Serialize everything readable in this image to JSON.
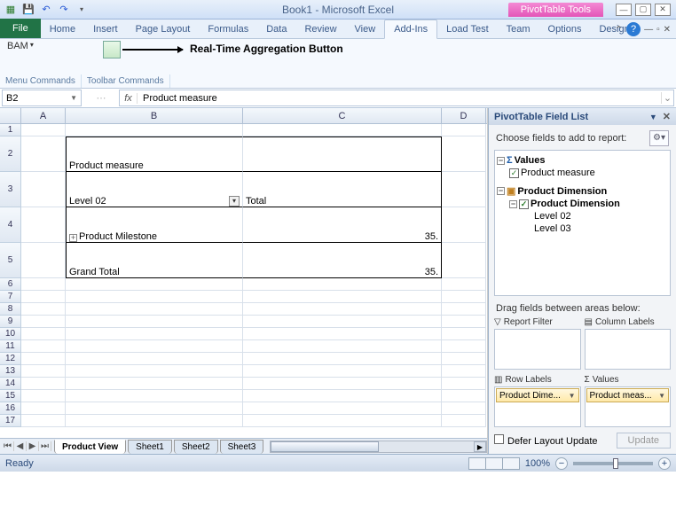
{
  "title": "Book1 - Microsoft Excel",
  "contextual_tab": "PivotTable Tools",
  "file_tab": "File",
  "tabs": [
    "Home",
    "Insert",
    "Page Layout",
    "Formulas",
    "Data",
    "Review",
    "View",
    "Add-Ins",
    "Load Test",
    "Team",
    "Options",
    "Design"
  ],
  "active_tab": "Add-Ins",
  "bam_label": "BAM",
  "rt_button_label": "Real-Time Aggregation Button",
  "ribbon_groups": [
    "Menu Commands",
    "Toolbar Commands"
  ],
  "namebox_value": "B2",
  "formula_value": "Product measure",
  "col_headers": [
    "A",
    "B",
    "C",
    "D"
  ],
  "pivot": {
    "r2_b": "Product measure",
    "r3_b": "Level 02",
    "r3_c": "Total",
    "r4_b": "Product Milestone",
    "r4_c": "35.",
    "r5_b": "Grand Total",
    "r5_c": "35."
  },
  "row_nums": [
    "1",
    "2",
    "3",
    "4",
    "5",
    "6",
    "7",
    "8",
    "9",
    "10",
    "11",
    "12",
    "13",
    "14",
    "15",
    "16",
    "17"
  ],
  "sheet_tabs": [
    "Product View",
    "Sheet1",
    "Sheet2",
    "Sheet3"
  ],
  "active_sheet": "Product View",
  "fieldlist": {
    "title": "PivotTable Field List",
    "choose_label": "Choose fields to add to report:",
    "values_node": "Values",
    "product_measure": "Product measure",
    "product_dim": "Product Dimension",
    "product_dim2": "Product Dimension",
    "level02": "Level 02",
    "level03": "Level 03",
    "drag_label": "Drag fields between areas below:",
    "area_filter": "Report Filter",
    "area_cols": "Column Labels",
    "area_rows": "Row Labels",
    "area_vals": "Values",
    "chip_rows": "Product Dime...",
    "chip_vals": "Product meas...",
    "defer_label": "Defer Layout Update",
    "update_btn": "Update"
  },
  "status": {
    "ready": "Ready",
    "zoom": "100%"
  }
}
